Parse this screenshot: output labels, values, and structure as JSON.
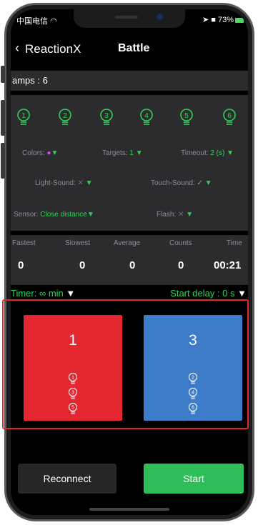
{
  "status": {
    "carrier": "中国电信",
    "battery": "73%"
  },
  "nav": {
    "app_name": "ReactionX",
    "title": "Battle"
  },
  "lamps": {
    "label": "amps : 6"
  },
  "bulbs": [
    "1",
    "2",
    "3",
    "4",
    "5",
    "6"
  ],
  "settings": {
    "colors_label": "Colors:",
    "targets_label": "Targets:",
    "targets_value": "1",
    "timeout_label": "Timeout:",
    "timeout_value": "2 (s)",
    "light_sound_label": "Light-Sound:",
    "light_sound_value": "✕",
    "touch_sound_label": "Touch-Sound:",
    "touch_sound_value": "✓",
    "sensor_label": "Sensor:",
    "sensor_value": "Close distance",
    "flash_label": "Flash:",
    "flash_value": "✕",
    "dropdown_glyph": "▼"
  },
  "stats": {
    "headers": [
      "Fastest",
      "Slowest",
      "Average",
      "Counts",
      "Time"
    ],
    "values": [
      "0",
      "0",
      "0",
      "0",
      "00:21"
    ]
  },
  "timer": {
    "label": "Timer: ∞ min",
    "start_delay": "Start delay : 0 s"
  },
  "players": [
    {
      "number": "1",
      "color": "#e3262f",
      "lamps": [
        "1",
        "3",
        "5"
      ]
    },
    {
      "number": "3",
      "color": "#3d7cc9",
      "lamps": [
        "2",
        "4",
        "6"
      ]
    }
  ],
  "buttons": {
    "reconnect": "Reconnect",
    "start": "Start"
  },
  "colors": {
    "accent_green": "#30d158",
    "start_green": "#2dbe5a",
    "highlight_red": "#e02a2a"
  }
}
